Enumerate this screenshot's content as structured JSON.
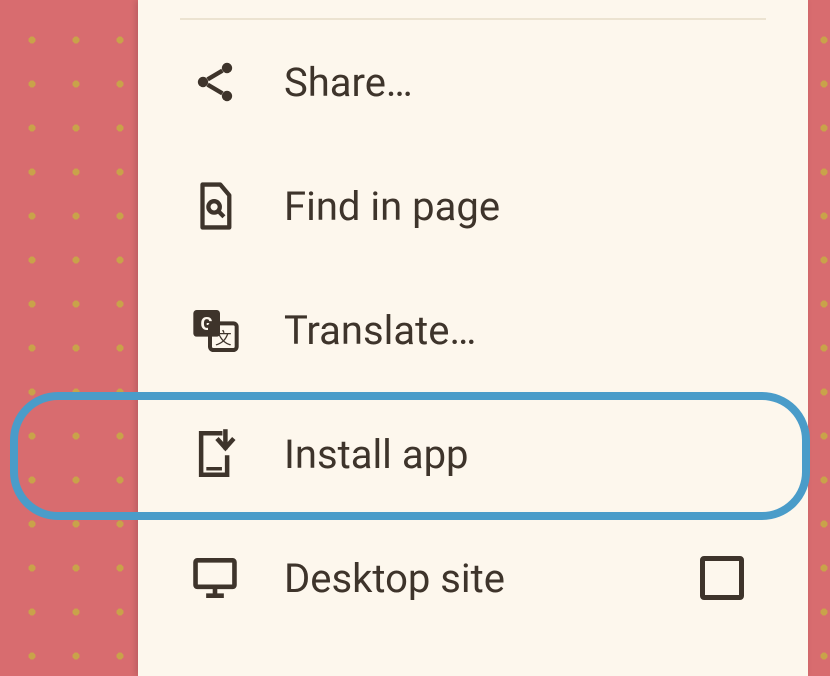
{
  "menu": {
    "items": [
      {
        "label": "Share…"
      },
      {
        "label": "Find in page"
      },
      {
        "label": "Translate…"
      },
      {
        "label": "Install app"
      },
      {
        "label": "Desktop site",
        "checked": false
      }
    ]
  }
}
